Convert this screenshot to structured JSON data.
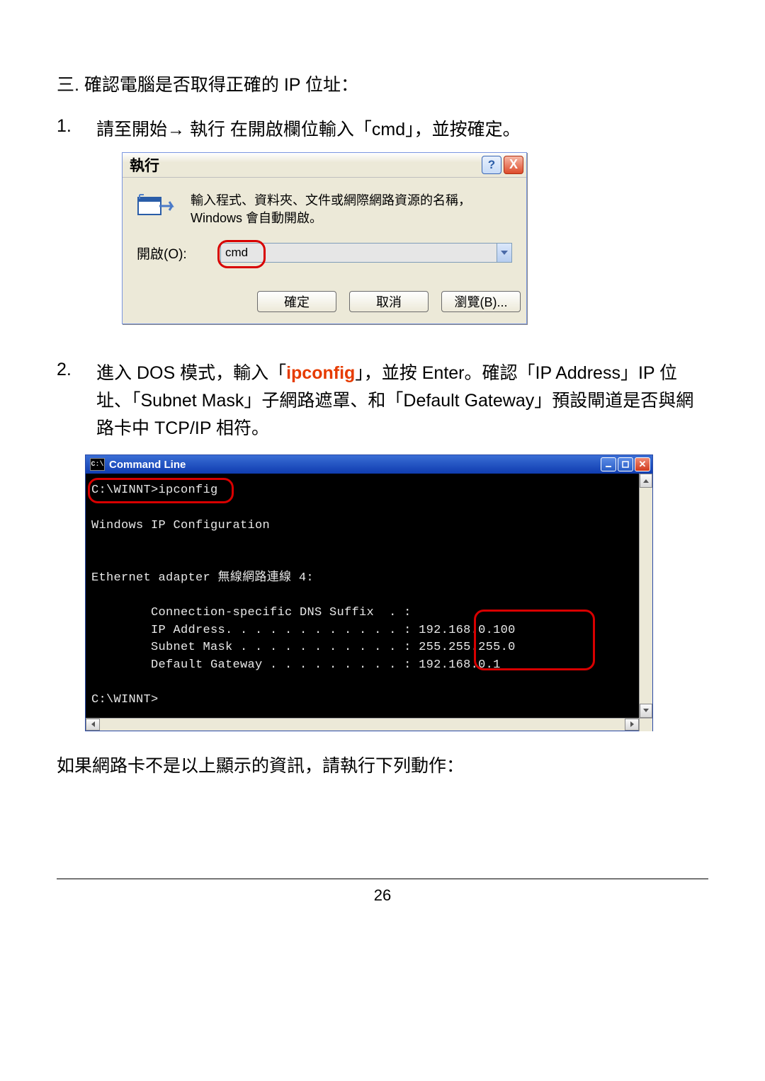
{
  "heading": "三. 確認電腦是否取得正確的 IP 位址：",
  "step1_num": "1.",
  "step1_text_a": "請至開始",
  "step1_text_b": " 執行 在開啟欄位輸入「cmd」，並按確定。",
  "run": {
    "title": "執行",
    "help": "?",
    "close": "X",
    "desc": "輸入程式、資料夾、文件或網際網路資源的名稱，Windows 會自動開啟。",
    "label": "開啟(O):",
    "value": "cmd",
    "ok": "確定",
    "cancel": "取消",
    "browse": "瀏覽(B)..."
  },
  "step2_num": "2.",
  "step2_pre": "進入 DOS 模式，輸入「",
  "step2_ip": "ipconfig",
  "step2_post": "」，並按 Enter。確認「IP Address」IP 位址、「Subnet Mask」子網路遮罩、和「Default Gateway」預設閘道是否與網路卡中 TCP/IP 相符。",
  "cmd": {
    "icon": "C:\\",
    "title": "Command Line",
    "line1": "C:\\WINNT>ipconfig",
    "line2": "Windows IP Configuration",
    "line3": "Ethernet adapter 無線網路連線 4:",
    "line4": "        Connection-specific DNS Suffix  . :",
    "line5": "        IP Address. . . . . . . . . . . . : 192.168.0.100",
    "line6": "        Subnet Mask . . . . . . . . . . . : 255.255.255.0",
    "line7": "        Default Gateway . . . . . . . . . : 192.168.0.1",
    "line8": "C:\\WINNT>"
  },
  "footnote": "如果網路卡不是以上顯示的資訊，請執行下列動作：",
  "page_number": "26",
  "chart_data": {
    "type": "table",
    "title": "ipconfig output",
    "rows": [
      {
        "field": "IP Address",
        "value": "192.168.0.100"
      },
      {
        "field": "Subnet Mask",
        "value": "255.255.255.0"
      },
      {
        "field": "Default Gateway",
        "value": "192.168.0.1"
      }
    ]
  }
}
